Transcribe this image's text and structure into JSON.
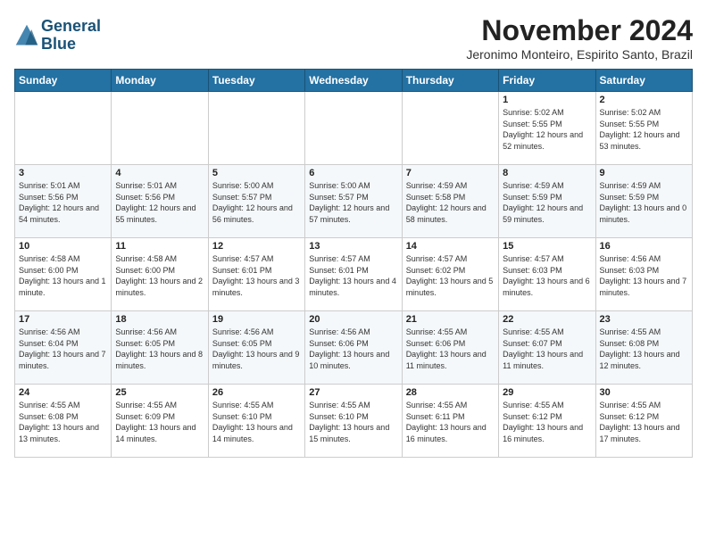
{
  "logo": {
    "name": "General",
    "name2": "Blue"
  },
  "header": {
    "month": "November 2024",
    "location": "Jeronimo Monteiro, Espirito Santo, Brazil"
  },
  "weekdays": [
    "Sunday",
    "Monday",
    "Tuesday",
    "Wednesday",
    "Thursday",
    "Friday",
    "Saturday"
  ],
  "weeks": [
    [
      {
        "day": "",
        "info": ""
      },
      {
        "day": "",
        "info": ""
      },
      {
        "day": "",
        "info": ""
      },
      {
        "day": "",
        "info": ""
      },
      {
        "day": "",
        "info": ""
      },
      {
        "day": "1",
        "info": "Sunrise: 5:02 AM\nSunset: 5:55 PM\nDaylight: 12 hours\nand 52 minutes."
      },
      {
        "day": "2",
        "info": "Sunrise: 5:02 AM\nSunset: 5:55 PM\nDaylight: 12 hours\nand 53 minutes."
      }
    ],
    [
      {
        "day": "3",
        "info": "Sunrise: 5:01 AM\nSunset: 5:56 PM\nDaylight: 12 hours\nand 54 minutes."
      },
      {
        "day": "4",
        "info": "Sunrise: 5:01 AM\nSunset: 5:56 PM\nDaylight: 12 hours\nand 55 minutes."
      },
      {
        "day": "5",
        "info": "Sunrise: 5:00 AM\nSunset: 5:57 PM\nDaylight: 12 hours\nand 56 minutes."
      },
      {
        "day": "6",
        "info": "Sunrise: 5:00 AM\nSunset: 5:57 PM\nDaylight: 12 hours\nand 57 minutes."
      },
      {
        "day": "7",
        "info": "Sunrise: 4:59 AM\nSunset: 5:58 PM\nDaylight: 12 hours\nand 58 minutes."
      },
      {
        "day": "8",
        "info": "Sunrise: 4:59 AM\nSunset: 5:59 PM\nDaylight: 12 hours\nand 59 minutes."
      },
      {
        "day": "9",
        "info": "Sunrise: 4:59 AM\nSunset: 5:59 PM\nDaylight: 13 hours\nand 0 minutes."
      }
    ],
    [
      {
        "day": "10",
        "info": "Sunrise: 4:58 AM\nSunset: 6:00 PM\nDaylight: 13 hours\nand 1 minute."
      },
      {
        "day": "11",
        "info": "Sunrise: 4:58 AM\nSunset: 6:00 PM\nDaylight: 13 hours\nand 2 minutes."
      },
      {
        "day": "12",
        "info": "Sunrise: 4:57 AM\nSunset: 6:01 PM\nDaylight: 13 hours\nand 3 minutes."
      },
      {
        "day": "13",
        "info": "Sunrise: 4:57 AM\nSunset: 6:01 PM\nDaylight: 13 hours\nand 4 minutes."
      },
      {
        "day": "14",
        "info": "Sunrise: 4:57 AM\nSunset: 6:02 PM\nDaylight: 13 hours\nand 5 minutes."
      },
      {
        "day": "15",
        "info": "Sunrise: 4:57 AM\nSunset: 6:03 PM\nDaylight: 13 hours\nand 6 minutes."
      },
      {
        "day": "16",
        "info": "Sunrise: 4:56 AM\nSunset: 6:03 PM\nDaylight: 13 hours\nand 7 minutes."
      }
    ],
    [
      {
        "day": "17",
        "info": "Sunrise: 4:56 AM\nSunset: 6:04 PM\nDaylight: 13 hours\nand 7 minutes."
      },
      {
        "day": "18",
        "info": "Sunrise: 4:56 AM\nSunset: 6:05 PM\nDaylight: 13 hours\nand 8 minutes."
      },
      {
        "day": "19",
        "info": "Sunrise: 4:56 AM\nSunset: 6:05 PM\nDaylight: 13 hours\nand 9 minutes."
      },
      {
        "day": "20",
        "info": "Sunrise: 4:56 AM\nSunset: 6:06 PM\nDaylight: 13 hours\nand 10 minutes."
      },
      {
        "day": "21",
        "info": "Sunrise: 4:55 AM\nSunset: 6:06 PM\nDaylight: 13 hours\nand 11 minutes."
      },
      {
        "day": "22",
        "info": "Sunrise: 4:55 AM\nSunset: 6:07 PM\nDaylight: 13 hours\nand 11 minutes."
      },
      {
        "day": "23",
        "info": "Sunrise: 4:55 AM\nSunset: 6:08 PM\nDaylight: 13 hours\nand 12 minutes."
      }
    ],
    [
      {
        "day": "24",
        "info": "Sunrise: 4:55 AM\nSunset: 6:08 PM\nDaylight: 13 hours\nand 13 minutes."
      },
      {
        "day": "25",
        "info": "Sunrise: 4:55 AM\nSunset: 6:09 PM\nDaylight: 13 hours\nand 14 minutes."
      },
      {
        "day": "26",
        "info": "Sunrise: 4:55 AM\nSunset: 6:10 PM\nDaylight: 13 hours\nand 14 minutes."
      },
      {
        "day": "27",
        "info": "Sunrise: 4:55 AM\nSunset: 6:10 PM\nDaylight: 13 hours\nand 15 minutes."
      },
      {
        "day": "28",
        "info": "Sunrise: 4:55 AM\nSunset: 6:11 PM\nDaylight: 13 hours\nand 16 minutes."
      },
      {
        "day": "29",
        "info": "Sunrise: 4:55 AM\nSunset: 6:12 PM\nDaylight: 13 hours\nand 16 minutes."
      },
      {
        "day": "30",
        "info": "Sunrise: 4:55 AM\nSunset: 6:12 PM\nDaylight: 13 hours\nand 17 minutes."
      }
    ]
  ]
}
